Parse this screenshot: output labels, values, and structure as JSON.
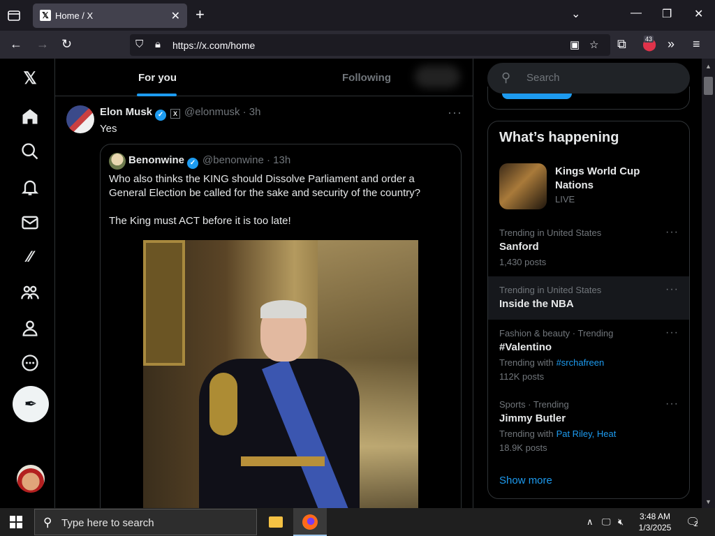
{
  "browser": {
    "tab_title": "Home / X",
    "url": "https://x.com/home",
    "extension_badge": "43"
  },
  "feed": {
    "tabs": [
      {
        "label": "For you",
        "active": true
      },
      {
        "label": "Following",
        "active": false
      }
    ]
  },
  "post": {
    "author_name": "Elon Musk",
    "affiliation_mark": "X",
    "meta": "@elonmusk · 3h",
    "text": "Yes",
    "more": "···",
    "quote": {
      "author_name": "Benonwine",
      "meta": "@benonwine · 13h",
      "text_1": "Who also thinks the KING should Dissolve Parliament and order a General Election be called for the sake and security of the country?",
      "text_2": "The King must ACT before it is too late!"
    }
  },
  "sidebar": {
    "search_placeholder": "Search",
    "whats_happening": "What’s happening",
    "featured": {
      "title": "Kings World Cup Nations",
      "status": "LIVE"
    },
    "trends": [
      {
        "meta": "Trending in United States",
        "name": "Sanford",
        "count": "1,430 posts"
      },
      {
        "meta": "Trending in United States",
        "name": "Inside the NBA"
      },
      {
        "meta": "Fashion & beauty · Trending",
        "name": "#Valentino",
        "with_label": "Trending with",
        "with_link": "#srchafreen",
        "count": "112K posts"
      },
      {
        "meta": "Sports · Trending",
        "name": "Jimmy Butler",
        "with_label": "Trending with",
        "with_link": "Pat Riley, Heat",
        "count": "18.9K posts"
      }
    ],
    "show_more": "Show more"
  },
  "taskbar": {
    "search_placeholder": "Type here to search",
    "time": "3:48 AM",
    "date": "1/3/2025",
    "notifications": "2"
  },
  "colors": {
    "accent": "#1d9bf0",
    "background": "#000000",
    "border": "#2f3336",
    "muted": "#71767b"
  }
}
